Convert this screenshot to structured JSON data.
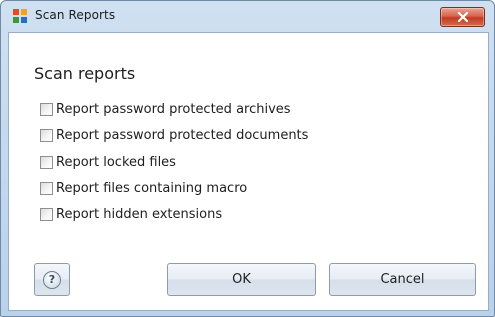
{
  "window": {
    "title": "Scan Reports",
    "icon": "avast-logo-icon",
    "close_icon": "close-icon"
  },
  "dialog": {
    "heading": "Scan reports",
    "options": [
      {
        "label": "Report password protected archives",
        "checked": false
      },
      {
        "label": "Report password protected documents",
        "checked": false
      },
      {
        "label": "Report locked files",
        "checked": false
      },
      {
        "label": "Report files containing macro",
        "checked": false
      },
      {
        "label": "Report hidden extensions",
        "checked": false
      }
    ]
  },
  "buttons": {
    "help_icon": "?",
    "ok_label": "OK",
    "cancel_label": "Cancel"
  },
  "colors": {
    "frame": "#b9d1ea",
    "close_button": "#c23b22"
  }
}
